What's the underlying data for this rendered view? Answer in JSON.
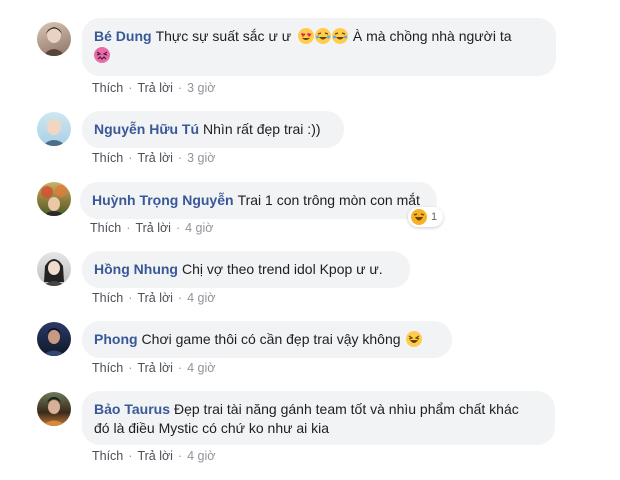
{
  "action_labels": {
    "like": "Thích",
    "reply": "Trả lời",
    "separator": "·"
  },
  "colors": {
    "author": "#385898",
    "bubble": "#f2f3f5",
    "meta": "#90949c"
  },
  "comments": [
    {
      "author": "Bé Dung",
      "text": "Thực sự suất sắc ư ư",
      "emojis_after_text": [
        "heart-eyes-icon",
        "crying-laughing-icon",
        "crying-laughing-icon"
      ],
      "text_2": "À mà chồng nhà người ta",
      "emojis_line_2": [
        "confounded-face-icon"
      ],
      "time": "3 giờ"
    },
    {
      "author": "Nguyễn Hữu Tú",
      "text": "Nhìn rất đẹp trai :))",
      "time": "3 giờ"
    },
    {
      "author": "Huỳnh Trọng Nguyễn",
      "text": "Trai 1 con trông mòn con mắt",
      "reaction": {
        "icon": "haha-reaction-icon",
        "count": "1"
      },
      "time": "4 giờ"
    },
    {
      "author": "Hồng Nhung",
      "text": "Chị vợ theo trend idol Kpop ư ư.",
      "time": "4 giờ"
    },
    {
      "author": "Phong",
      "text": "Chơi game thôi có cần đẹp trai vậy không",
      "emojis_after_text": [
        "grinning-squint-icon"
      ],
      "time": "4 giờ"
    },
    {
      "author": "Bảo Taurus",
      "text": "Đẹp trai tài năng gánh team tốt và nhìu phẩm chất khác",
      "text_2": "đó là điều Mystic có chứ ko như ai kia",
      "time": "4 giờ"
    }
  ]
}
